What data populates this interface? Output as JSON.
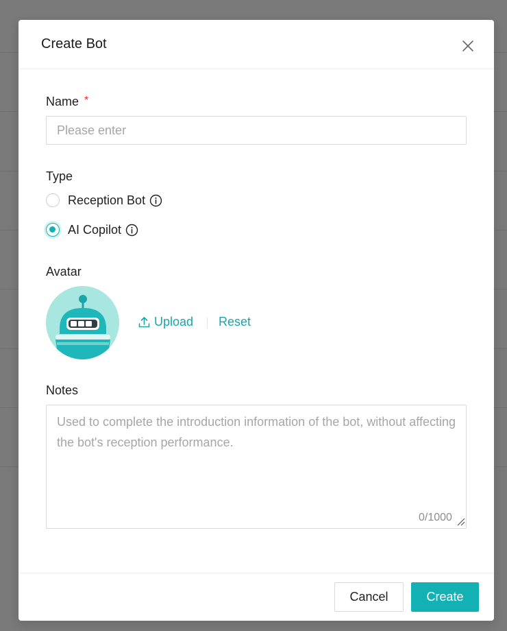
{
  "dialog": {
    "title": "Create Bot"
  },
  "form": {
    "name": {
      "label": "Name",
      "required_mark": "*",
      "value": "",
      "placeholder": "Please enter"
    },
    "type": {
      "label": "Type",
      "options": [
        {
          "label": "Reception Bot",
          "selected": false
        },
        {
          "label": "AI Copilot",
          "selected": true
        }
      ]
    },
    "avatar": {
      "label": "Avatar",
      "upload_label": "Upload",
      "reset_label": "Reset"
    },
    "notes": {
      "label": "Notes",
      "value": "",
      "placeholder": "Used to complete the introduction information of the bot, without affecting the bot's reception performance.",
      "counter": "0/1000"
    }
  },
  "footer": {
    "cancel_label": "Cancel",
    "create_label": "Create"
  },
  "colors": {
    "accent": "#14b1b4",
    "link": "#14a8ab",
    "required": "#e0282e",
    "overlay": "#7a7a7a"
  },
  "icons": {
    "close": "close-icon",
    "info": "info-icon",
    "upload": "upload-icon",
    "resize": "resize-handle-icon"
  }
}
